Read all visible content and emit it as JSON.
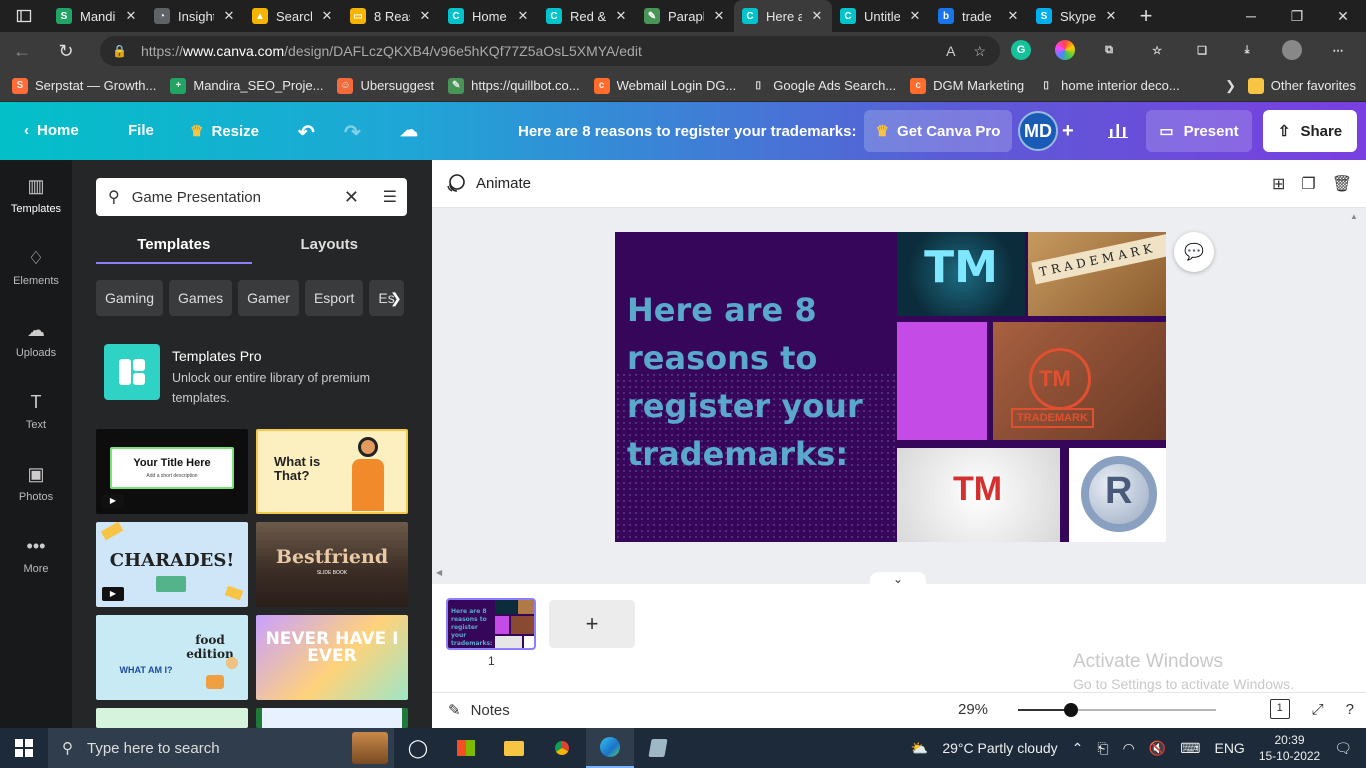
{
  "browser": {
    "tabs": [
      {
        "title": "Mandi",
        "icon": "sheets-icon",
        "color": "#21a464",
        "glyph": "S"
      },
      {
        "title": "Insight",
        "icon": "analytics-icon",
        "color": "#5f6368",
        "glyph": "◔"
      },
      {
        "title": "Search",
        "icon": "drive-icon",
        "color": "#f4b400",
        "glyph": "▲"
      },
      {
        "title": "8 Reas",
        "icon": "slides-icon",
        "color": "#f4b400",
        "glyph": "▭"
      },
      {
        "title": "Home",
        "icon": "canva-icon",
        "color": "#00c4cc",
        "glyph": "C"
      },
      {
        "title": "Red &",
        "icon": "canva-icon",
        "color": "#00c4cc",
        "glyph": "C"
      },
      {
        "title": "Parapl",
        "icon": "quillbot-icon",
        "color": "#499557",
        "glyph": "✎"
      },
      {
        "title": "Here a",
        "icon": "canva-icon",
        "color": "#00c4cc",
        "glyph": "C",
        "active": true
      },
      {
        "title": "Untitle",
        "icon": "canva-icon",
        "color": "#00c4cc",
        "glyph": "C"
      },
      {
        "title": "trade",
        "icon": "bing-icon",
        "color": "#1a73e8",
        "glyph": "b"
      },
      {
        "title": "Skype",
        "icon": "skype-icon",
        "color": "#00aff0",
        "glyph": "S"
      }
    ],
    "url_prefix": "https://",
    "url_host": "www.canva.com",
    "url_path": "/design/DAFLczQKXB4/v96e5hKQf77Z5aOsL5XMYA/edit",
    "bookmarks": [
      {
        "label": "Serpstat — Growth...",
        "icon": "serpstat-icon",
        "color": "#ff6c37",
        "glyph": "S"
      },
      {
        "label": "Mandira_SEO_Proje...",
        "icon": "sheets-icon",
        "color": "#21a464",
        "glyph": "+"
      },
      {
        "label": "Ubersuggest",
        "icon": "ubersuggest-icon",
        "color": "#f26b3a",
        "glyph": "☺"
      },
      {
        "label": "https://quillbot.co...",
        "icon": "quillbot-icon",
        "color": "#499557",
        "glyph": "✎"
      },
      {
        "label": "Webmail Login DG...",
        "icon": "cpanel-icon",
        "color": "#ff6c2c",
        "glyph": "c"
      },
      {
        "label": "Google Ads Search...",
        "icon": "page-icon",
        "color": "#3b3b3b",
        "glyph": "▯"
      },
      {
        "label": "DGM Marketing",
        "icon": "cpanel-icon",
        "color": "#ff6c2c",
        "glyph": "c"
      },
      {
        "label": "home interior deco...",
        "icon": "page-icon",
        "color": "#3b3b3b",
        "glyph": "▯"
      }
    ],
    "other_favorites": "Other favorites"
  },
  "header": {
    "home": "Home",
    "file": "File",
    "resize": "Resize",
    "title": "Here are 8 reasons to register your trademarks:",
    "get_pro": "Get Canva Pro",
    "avatar_initials": "MD",
    "present": "Present",
    "share": "Share"
  },
  "rail": [
    {
      "label": "Templates",
      "icon": "templates-icon",
      "glyph": "▥"
    },
    {
      "label": "Elements",
      "icon": "elements-icon",
      "glyph": "♢"
    },
    {
      "label": "Uploads",
      "icon": "upload-icon",
      "glyph": "☁"
    },
    {
      "label": "Text",
      "icon": "text-icon",
      "glyph": "T"
    },
    {
      "label": "Photos",
      "icon": "photos-icon",
      "glyph": "▣"
    },
    {
      "label": "More",
      "icon": "more-icon",
      "glyph": "•••"
    }
  ],
  "panel": {
    "search_value": "Game Presentation",
    "tabs": [
      "Templates",
      "Layouts"
    ],
    "chips": [
      "Gaming",
      "Games",
      "Gamer",
      "Esport",
      "Es"
    ],
    "pro_title": "Templates Pro",
    "pro_desc": "Unlock our entire library of premium templates.",
    "thumbs": [
      {
        "text": "Your Title Here",
        "sub": "Add a short description"
      },
      {
        "text": "What is That?",
        "sub": ""
      },
      {
        "text": "CHARADES!",
        "sub": ""
      },
      {
        "text": "Bestfriend",
        "sub": "SLIDE BOOK"
      },
      {
        "text": "food edition",
        "sub": "WHAT AM I?"
      },
      {
        "text": "NEVER HAVE I EVER",
        "sub": ""
      }
    ]
  },
  "editor": {
    "animate": "Animate",
    "slide_title": "Here are 8 reasons to register your trademarks:",
    "images": [
      "TM",
      "TRADEMARK",
      "TM",
      "TM",
      "R"
    ],
    "page_number": "1",
    "notes": "Notes",
    "zoom": "29%",
    "zoom_fraction": 0.27,
    "page_box": "1"
  },
  "watermark": {
    "line1": "Activate Windows",
    "line2": "Go to Settings to activate Windows."
  },
  "taskbar": {
    "search_placeholder": "Type here to search",
    "weather": "29°C  Partly cloudy",
    "lang": "ENG",
    "time": "20:39",
    "date": "15-10-2022"
  },
  "colors": {
    "canva_teal": "#00c4cc",
    "canva_purple": "#7a3fe0",
    "slide_bg": "#35065a",
    "slide_text": "#5aa9cc",
    "magenta_block": "#c44be6"
  }
}
